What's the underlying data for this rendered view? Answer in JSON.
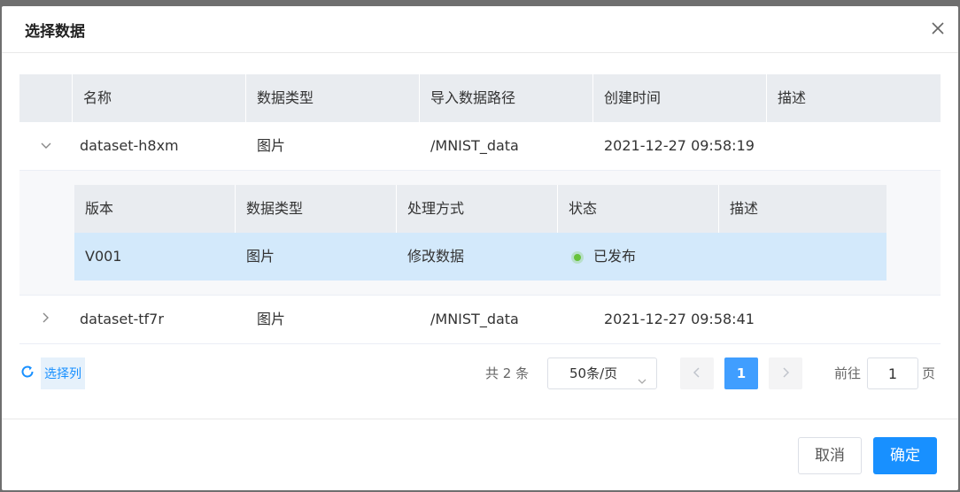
{
  "dialog": {
    "title": "选择数据",
    "cancel_label": "取消",
    "ok_label": "确定"
  },
  "table": {
    "columns": [
      "名称",
      "数据类型",
      "导入数据路径",
      "创建时间",
      "描述"
    ],
    "rows": [
      {
        "name": "dataset-h8xm",
        "type": "图片",
        "path": "/MNIST_data",
        "created": "2021-12-27 09:58:19",
        "desc": "",
        "expanded": true
      },
      {
        "name": "dataset-tf7r",
        "type": "图片",
        "path": "/MNIST_data",
        "created": "2021-12-27 09:58:41",
        "desc": "",
        "expanded": false
      }
    ]
  },
  "sub_table": {
    "columns": [
      "版本",
      "数据类型",
      "处理方式",
      "状态",
      "描述"
    ],
    "rows": [
      {
        "version": "V001",
        "type": "图片",
        "method": "修改数据",
        "status": "已发布",
        "desc": ""
      }
    ],
    "status_color": "#67c23a",
    "selected_row_color": "#d3e9fb"
  },
  "toolbar": {
    "select_columns_label": "选择列",
    "total_text": "共 2 条",
    "page_size": "50条/页",
    "current_page": "1",
    "goto_prefix": "前往",
    "goto_value": "1",
    "goto_suffix": "页"
  },
  "colors": {
    "primary": "#1890ff",
    "pagination_active": "#409eff"
  }
}
